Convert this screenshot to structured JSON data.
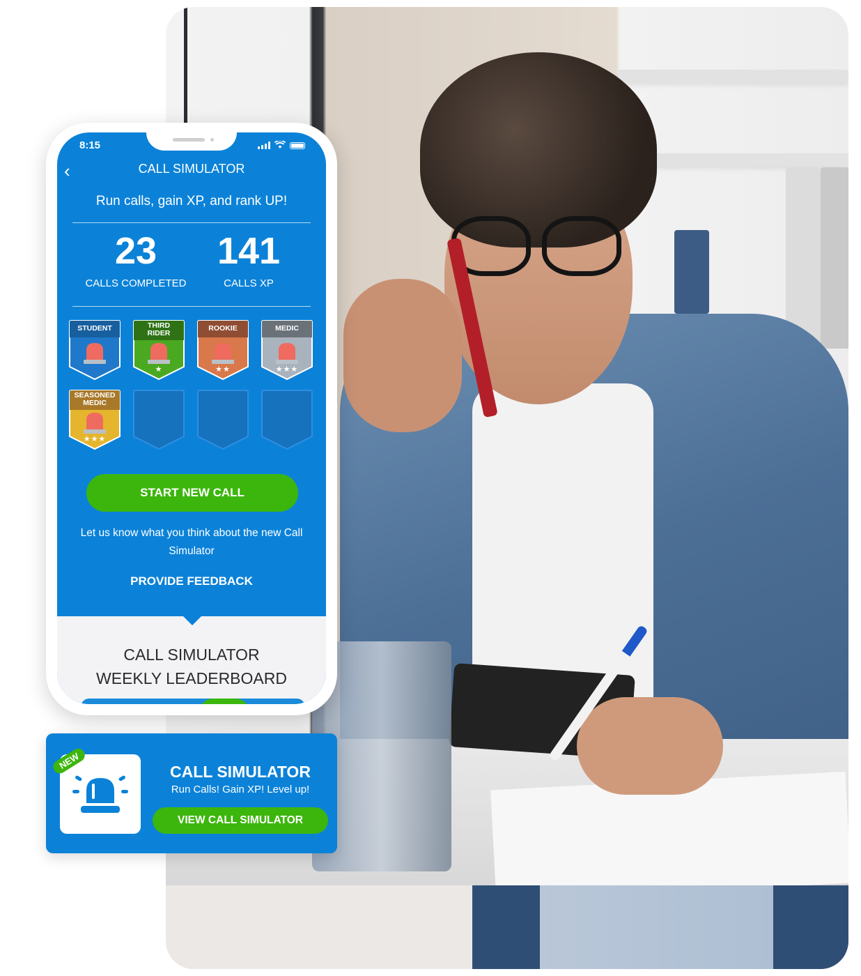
{
  "phone": {
    "status": {
      "time": "8:15"
    },
    "header": {
      "title": "CALL SIMULATOR",
      "back_icon": "chevron-left-icon"
    },
    "subtitle": "Run calls, gain XP, and rank UP!",
    "stats": [
      {
        "value": "23",
        "label": "CALLS COMPLETED"
      },
      {
        "value": "141",
        "label": "CALLS XP"
      }
    ],
    "badges": [
      {
        "title": "STUDENT",
        "stars": "",
        "color": "#1f78c9",
        "header_color": "#175f9f",
        "earned": true
      },
      {
        "title": "THIRD RIDER",
        "stars": "★",
        "color": "#4aa920",
        "header_color": "#2f7216",
        "earned": true
      },
      {
        "title": "ROOKIE",
        "stars": "★★",
        "color": "#d9784a",
        "header_color": "#8f4d33",
        "earned": true
      },
      {
        "title": "MEDIC",
        "stars": "★★★",
        "color": "#a9b3bd",
        "header_color": "#6a7178",
        "earned": true
      },
      {
        "title": "SEASONED MEDIC",
        "stars": "★★★",
        "color": "#e5b52e",
        "header_color": "#a9792a",
        "earned": true
      },
      {
        "title": "",
        "stars": "",
        "color": "#1672bd",
        "header_color": "#1672bd",
        "earned": false
      },
      {
        "title": "",
        "stars": "",
        "color": "#1672bd",
        "header_color": "#1672bd",
        "earned": false
      },
      {
        "title": "",
        "stars": "",
        "color": "#1672bd",
        "header_color": "#1672bd",
        "earned": false
      }
    ],
    "start_button": "START NEW CALL",
    "feedback_text": "Let us know what you think about the new Call Simulator",
    "feedback_link": "PROVIDE FEEDBACK",
    "leaderboard": {
      "line1": "CALL SIMULATOR",
      "line2": "WEEKLY LEADERBOARD"
    }
  },
  "promo": {
    "new_tag": "NEW",
    "icon": "siren-icon",
    "title": "CALL SIMULATOR",
    "subtitle": "Run Calls! Gain XP! Level up!",
    "button": "VIEW CALL SIMULATOR"
  },
  "colors": {
    "brand_blue": "#0b82d8",
    "action_green": "#3cb60d",
    "leaderboard_bg": "#f3f3f6"
  }
}
